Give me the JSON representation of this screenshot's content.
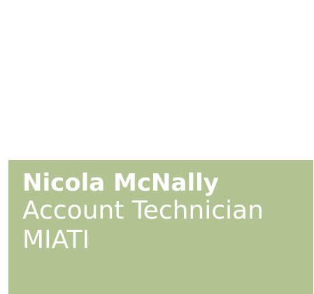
{
  "profile": {
    "name": "Nicola McNally",
    "role": "Account Technician",
    "credential": "MIATI"
  },
  "colors": {
    "card_background": "#b3c291",
    "text": "#ffffff",
    "page_background": "#ffffff"
  }
}
